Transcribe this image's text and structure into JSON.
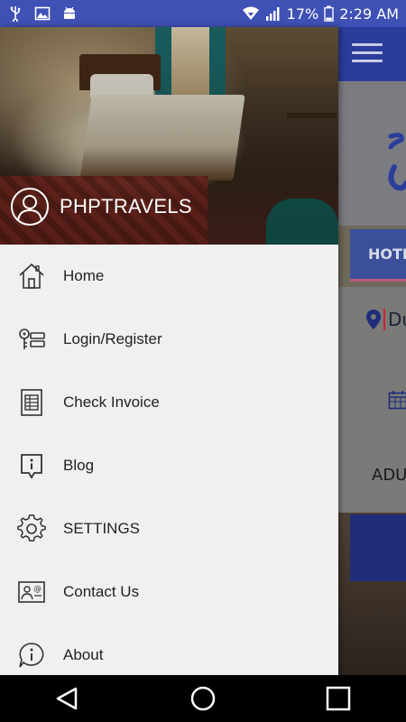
{
  "status_bar": {
    "battery": "17%",
    "time": "2:29 AM"
  },
  "background_app": {
    "tab_label": "HOTE",
    "location_text": "Du",
    "adults_text": "ADU"
  },
  "drawer": {
    "brand_name": "PHPTRAVELS",
    "items": [
      {
        "label": "Home",
        "icon": "home-icon"
      },
      {
        "label": "Login/Register",
        "icon": "key-icon"
      },
      {
        "label": "Check Invoice",
        "icon": "invoice-icon"
      },
      {
        "label": "Blog",
        "icon": "blog-icon"
      },
      {
        "label": "SETTINGS",
        "icon": "gear-icon"
      },
      {
        "label": "Contact Us",
        "icon": "contact-icon"
      },
      {
        "label": "About",
        "icon": "info-icon"
      }
    ]
  },
  "colors": {
    "status_bar": "#3f51b5",
    "toolbar": "#2b3d9a",
    "drawer_bg": "#f0f0f0"
  }
}
